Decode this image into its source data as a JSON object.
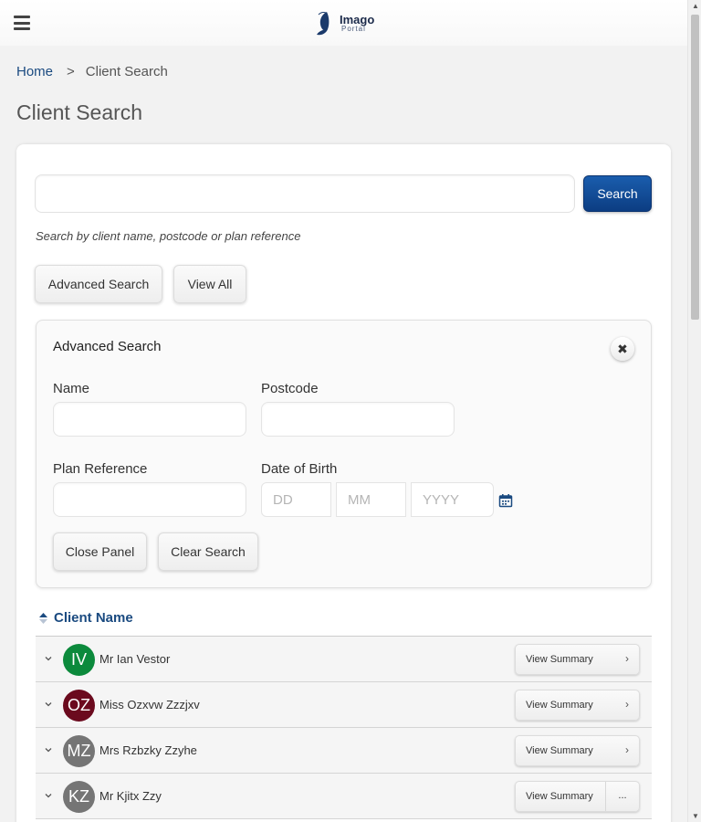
{
  "header": {
    "logo_title": "Imago",
    "logo_subtitle": "Portal"
  },
  "breadcrumb": {
    "home": "Home",
    "separator": ">",
    "current": "Client Search"
  },
  "page": {
    "title": "Client Search"
  },
  "search": {
    "placeholder": "",
    "button_label": "Search",
    "hint": "Search by client name, postcode or plan reference",
    "advanced_label": "Advanced Search",
    "view_all_label": "View All"
  },
  "advanced_panel": {
    "title": "Advanced Search",
    "close_glyph": "✖",
    "name_label": "Name",
    "postcode_label": "Postcode",
    "plan_ref_label": "Plan Reference",
    "dob_label": "Date of Birth",
    "dob_day_placeholder": "DD",
    "dob_month_placeholder": "MM",
    "dob_year_placeholder": "YYYY",
    "close_panel_label": "Close Panel",
    "clear_search_label": "Clear Search"
  },
  "table": {
    "sort_header": "Client Name",
    "rows": [
      {
        "initials": "IV",
        "name": "Mr Ian Vestor",
        "avatar_color": "#0c8a3c",
        "action": "View Summary",
        "action_icon": "chevron-right"
      },
      {
        "initials": "OZ",
        "name": "Miss Ozxvw Zzzjxv",
        "avatar_color": "#6b0a1e",
        "action": "View Summary",
        "action_icon": "chevron-right"
      },
      {
        "initials": "MZ",
        "name": "Mrs Rzbzky Zzyhe",
        "avatar_color": "#757575",
        "action": "View Summary",
        "action_icon": "chevron-right"
      },
      {
        "initials": "KZ",
        "name": "Mr Kjitx Zzy",
        "avatar_color": "#757575",
        "action": "View Summary",
        "action_icon": "more"
      }
    ]
  },
  "colors": {
    "brand": "#0c3d82",
    "link": "#1a4a80"
  }
}
